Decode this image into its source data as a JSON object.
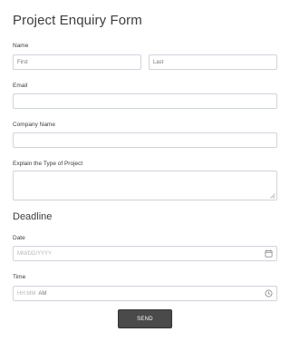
{
  "form": {
    "title": "Project Enquiry Form",
    "name": {
      "label": "Name",
      "first_placeholder": "First",
      "last_placeholder": "Last"
    },
    "email": {
      "label": "Email",
      "value": ""
    },
    "company": {
      "label": "Company Name",
      "value": ""
    },
    "project_type": {
      "label": "Explain the Type of Project",
      "value": ""
    },
    "deadline": {
      "section_title": "Deadline",
      "date": {
        "label": "Date",
        "placeholder": "MM/DD/YYYY",
        "icon": "calendar-icon"
      },
      "time": {
        "label": "Time",
        "placeholder": "HH:MM",
        "ampm": "AM",
        "icon": "clock-icon"
      }
    },
    "submit_label": "SEND"
  }
}
